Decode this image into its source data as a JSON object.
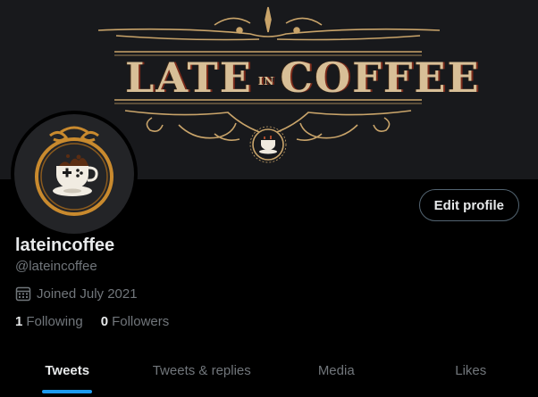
{
  "banner": {
    "title": "LATE COFFEE",
    "title_small": "IN",
    "accent_color": "#c9a46a"
  },
  "avatar": {
    "icon": "coffee-cup-emblem-icon"
  },
  "edit_profile_label": "Edit profile",
  "profile": {
    "display_name": "lateincoffee",
    "handle": "@lateincoffee",
    "joined": "Joined July 2021",
    "following_count": "1",
    "following_label": "Following",
    "followers_count": "0",
    "followers_label": "Followers"
  },
  "tabs": [
    {
      "label": "Tweets",
      "active": true
    },
    {
      "label": "Tweets & replies",
      "active": false
    },
    {
      "label": "Media",
      "active": false
    },
    {
      "label": "Likes",
      "active": false
    }
  ],
  "colors": {
    "background": "#000000",
    "text": "#e7e9ea",
    "muted": "#71767b",
    "accent": "#1d9bf0"
  }
}
